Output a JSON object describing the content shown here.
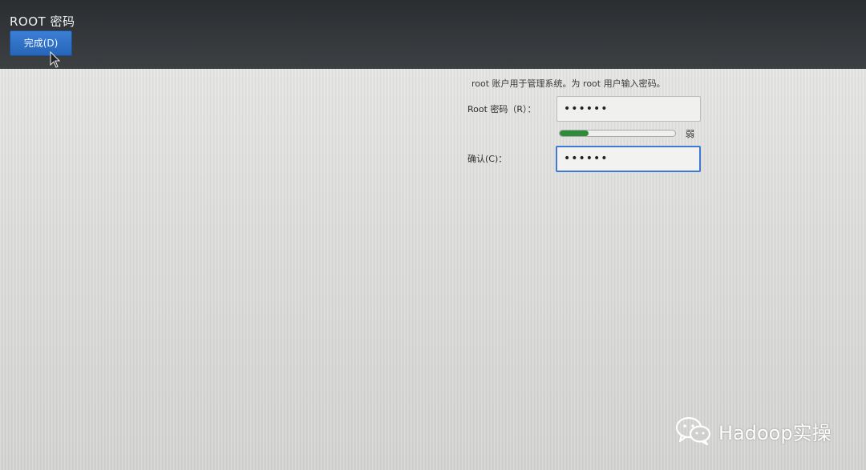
{
  "header": {
    "title": "ROOT 密码",
    "done_label": "完成(D)"
  },
  "form": {
    "description": "root 账户用于管理系统。为 root 用户输入密码。",
    "root_password_label": "Root 密码（R）：",
    "root_password_value": "••••••",
    "strength_text": "弱",
    "strength_level": 0.25,
    "confirm_label": "确认(C)：",
    "confirm_value": "••••••"
  },
  "watermark": {
    "text": "Hadoop实操",
    "icon": "wechat-icon"
  },
  "colors": {
    "accent": "#3f7ad2",
    "button": "#2765b8",
    "strength_weak": "#2f8a3a",
    "header_bg": "#2b2e31"
  }
}
